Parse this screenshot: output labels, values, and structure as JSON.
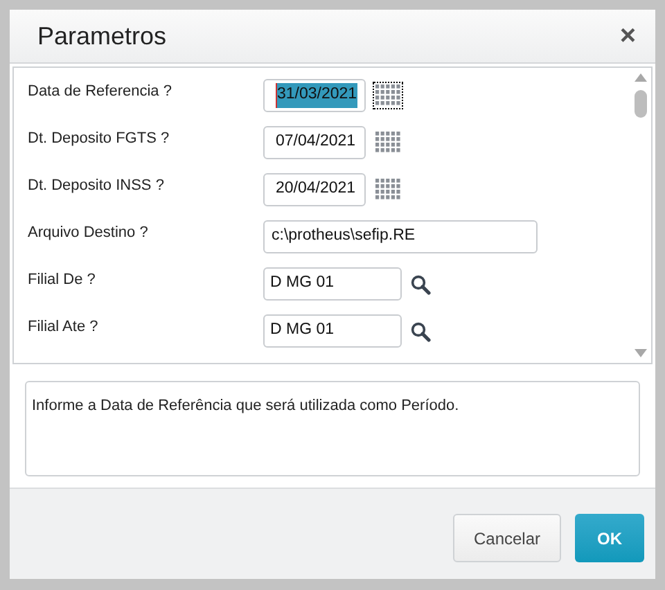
{
  "dialog": {
    "title": "Parametros",
    "close": "×"
  },
  "parameters": [
    {
      "label": "Data de Referencia ?",
      "value": "31/03/2021",
      "kind": "date",
      "selected": true
    },
    {
      "label": "Dt. Deposito FGTS ?",
      "value": "07/04/2021",
      "kind": "date",
      "selected": false
    },
    {
      "label": "Dt. Deposito INSS ?",
      "value": "20/04/2021",
      "kind": "date",
      "selected": false
    },
    {
      "label": "Arquivo Destino ?",
      "value": "c:\\protheus\\sefip.RE",
      "kind": "text",
      "selected": false
    },
    {
      "label": "Filial De ?",
      "value": "D MG 01",
      "kind": "lookup",
      "selected": false
    },
    {
      "label": "Filial Ate ?",
      "value": "D MG 01",
      "kind": "lookup",
      "selected": false
    }
  ],
  "help": "Informe a Data de Referência que será utilizada como Período.",
  "buttons": [
    {
      "label": "Cancelar",
      "kind": "secondary"
    },
    {
      "label": "OK",
      "kind": "primary"
    }
  ]
}
